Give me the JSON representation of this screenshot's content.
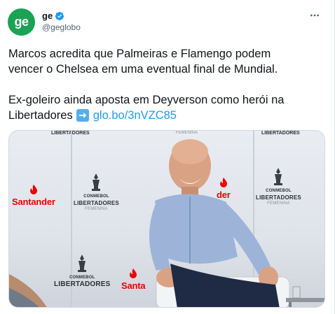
{
  "account": {
    "avatar_text": "ge",
    "avatar_color": "#1aa355",
    "name": "ge",
    "handle": "@geglobo",
    "verified": true
  },
  "tweet": {
    "line1": "Marcos acredita que Palmeiras e Flamengo podem",
    "line2": "vencer o Chelsea em uma eventual final de Mundial.",
    "line3": "Ex-goleiro ainda aposta em Deyverson como herói na",
    "line4_text": "Libertadores",
    "line4_link": "glo.bo/3nVZC85"
  },
  "media": {
    "backdrop_texts": {
      "libertadores": "LIBERTADORES",
      "conmebol": "CONMEBOL",
      "femenina": "FEMENINA",
      "santander": "Santander",
      "sant_partial": "Santa",
      "der_partial": "der",
      "top_left": "LIBERTADORES",
      "top_mid": "FEMENINA",
      "top_right": "LIBERTADORES"
    }
  },
  "colors": {
    "link": "#1d9bf0",
    "text": "#0f1419",
    "muted": "#536471",
    "santander_red": "#ec0000"
  }
}
